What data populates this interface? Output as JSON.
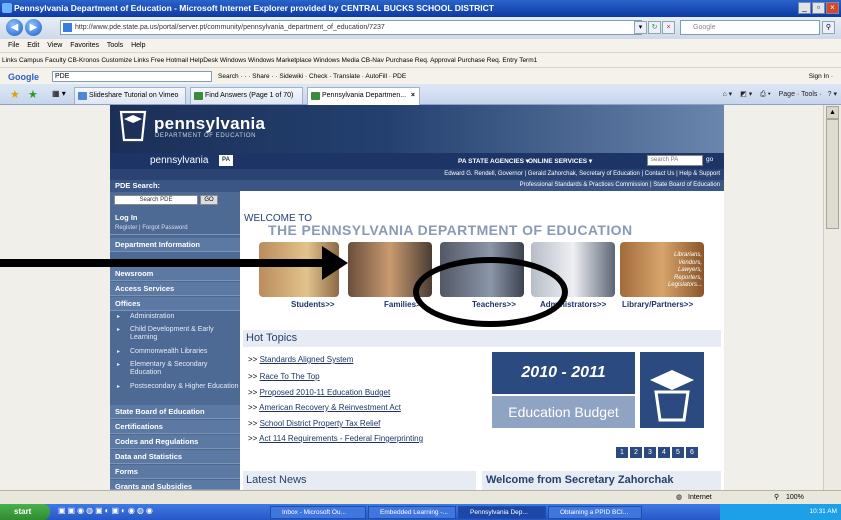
{
  "window": {
    "title": "Pennsylvania Department of Education - Microsoft Internet Explorer provided by CENTRAL BUCKS SCHOOL DISTRICT"
  },
  "address": {
    "url": "http://www.pde.state.pa.us/portal/server.pt/community/pennsylvania_department_of_education/7237",
    "search_placeholder": "Google"
  },
  "menu": "File  Edit  View  Favorites  Tools  Help",
  "links": "Links  Campus Faculty  CB-Kronos  Customize Links  Free Hotmail  HelpDesk  Windows  Windows Marketplace  Windows Media  CB-Nav  Purchase Req. Approval  Purchase Req. Entry  Term1",
  "google": {
    "logo": "Google",
    "query": "PDE",
    "tools": "Search ·  ·  ·  Share ·  ·  Sidewiki ·  Check ·  Translate ·  AutoFill ·  PDE",
    "signin": "Sign In ·"
  },
  "tabs": [
    "Slideshare Tutorial on Vimeo",
    "Find Answers (Page 1 of 70)",
    "Pennsylvania Departmen..."
  ],
  "commands": "Page ·  Tools ·",
  "site": {
    "logo": "pennsylvania",
    "logo_sub": "DEPARTMENT OF EDUCATION",
    "brand": "pennsylvania",
    "badge": "PA",
    "agencies": "PA STATE AGENCIES ▾",
    "services": "ONLINE SERVICES ▾",
    "search_placeholder": "search PA",
    "go": "go",
    "info1": "Edward G. Rendell, Governor | Gerald Zahorchak, Secretary of Education | Contact Us | Help & Support",
    "info2": "Professional Standards & Practices Commission | State Board of Education",
    "pde_search": "PDE Search:",
    "pde_search_btn": "Search PDE",
    "pde_go": "GO",
    "login": "Log In",
    "login_sub": "Register | Forgot Password",
    "nav": [
      "Department Information",
      "Newsroom",
      "Access Services",
      "Offices"
    ],
    "offices": [
      "Administration",
      "Child Development & Early Learning",
      "Commonwealth Libraries",
      "Elementary & Secondary Education",
      "Postsecondary & Higher Education"
    ],
    "nav2": [
      "State Board of Education",
      "Certifications",
      "Codes and Regulations",
      "Data and Statistics",
      "Forms",
      "Grants and Subsidies"
    ],
    "welcome_small": "WELCOME TO",
    "welcome_big": "THE PENNSYLVANIA DEPARTMENT OF EDUCATION",
    "cats": [
      "Students>>",
      "Families>>",
      "Teachers>>",
      "Administrators>>",
      "Library/Partners>>"
    ],
    "lib_text": "Librarians, Vendors, Lawyers, Reporters, Legislators...",
    "hot_title": "Hot Topics",
    "hot": [
      "Standards Aligned System",
      "Race To The Top",
      "Proposed 2010-11 Education Budget",
      "American Recovery & Reinvestment Act",
      "School District Property Tax Relief",
      "Act 114 Requirements - Federal Fingerprinting"
    ],
    "budget_year": "2010 - 2011",
    "budget_label": "Education Budget",
    "pages": [
      "1",
      "2",
      "3",
      "4",
      "5",
      "6"
    ],
    "latest": "Latest News",
    "welcome_sec": "Welcome from Secretary Zahorchak"
  },
  "status": {
    "zone": "Internet",
    "zoom": "100%"
  },
  "taskbar": {
    "start": "start",
    "tasks": [
      "Inbox - Microsoft Ou...",
      "Embedded Learning -...",
      "Pennsylvania Dep...",
      "Obtaining a PPID BCI..."
    ],
    "time": "10:31 AM"
  }
}
